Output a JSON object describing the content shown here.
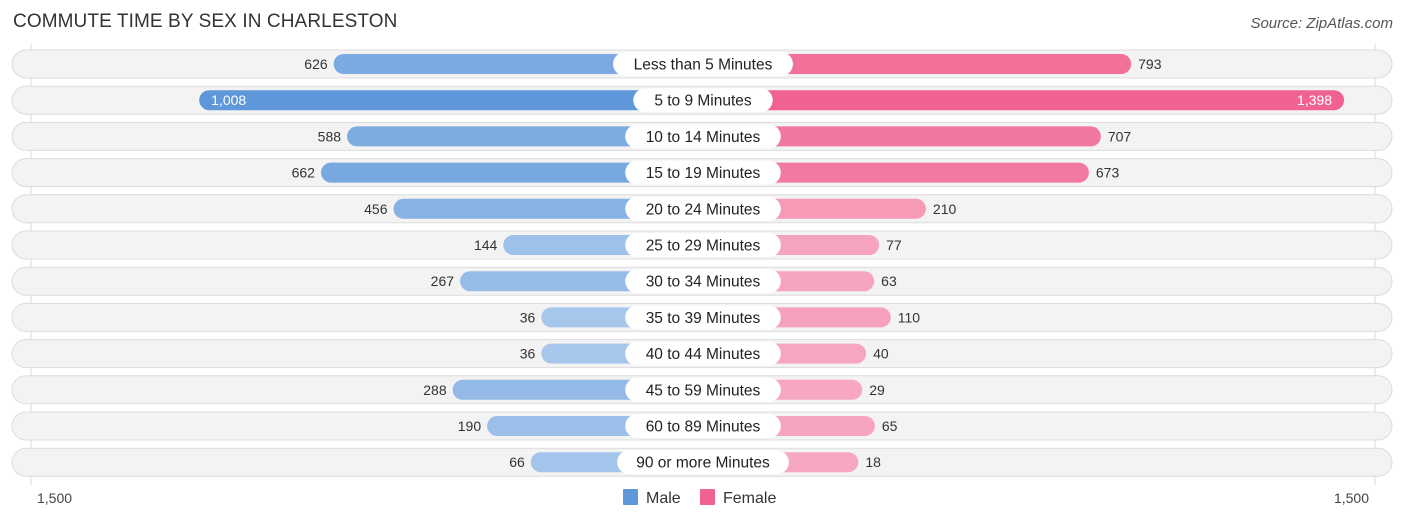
{
  "header": {
    "title": "COMMUTE TIME BY SEX IN CHARLESTON",
    "source": "Source: ZipAtlas.com"
  },
  "chart_data": {
    "type": "bar",
    "orientation": "horizontal-diverging",
    "title": "COMMUTE TIME BY SEX IN CHARLESTON",
    "source": "Source: ZipAtlas.com",
    "categories": [
      "Less than 5 Minutes",
      "5 to 9 Minutes",
      "10 to 14 Minutes",
      "15 to 19 Minutes",
      "20 to 24 Minutes",
      "25 to 29 Minutes",
      "30 to 34 Minutes",
      "35 to 39 Minutes",
      "40 to 44 Minutes",
      "45 to 59 Minutes",
      "60 to 89 Minutes",
      "90 or more Minutes"
    ],
    "series": [
      {
        "name": "Male",
        "side": "left",
        "color": "#6a9fdb",
        "values": [
          626,
          1008,
          588,
          662,
          456,
          144,
          267,
          36,
          36,
          288,
          190,
          66
        ],
        "labels": [
          "626",
          "1,008",
          "588",
          "662",
          "456",
          "144",
          "267",
          "36",
          "36",
          "288",
          "190",
          "66"
        ]
      },
      {
        "name": "Female",
        "side": "right",
        "color": "#f06792",
        "values": [
          793,
          1398,
          707,
          673,
          210,
          77,
          63,
          110,
          40,
          29,
          65,
          18
        ],
        "labels": [
          "793",
          "1,398",
          "707",
          "673",
          "210",
          "77",
          "63",
          "110",
          "40",
          "29",
          "65",
          "18"
        ]
      }
    ],
    "axis": {
      "min_label": "1,500",
      "max_label": "1,500",
      "range": [
        -1500,
        1500
      ]
    },
    "legend": {
      "position": "bottom-center",
      "items": [
        "Male",
        "Female"
      ]
    },
    "grid": false
  }
}
